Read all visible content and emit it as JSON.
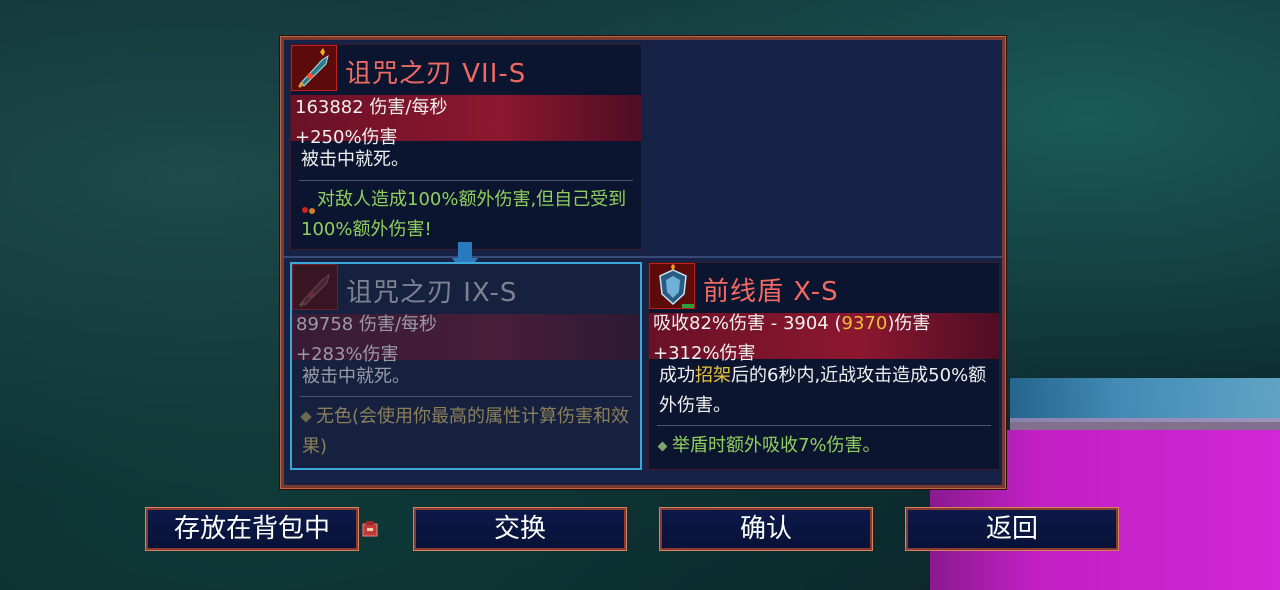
{
  "current_item": {
    "name": "诅咒之刃  VII-S",
    "dps_line": "163882 伤害/每秒",
    "damage_bonus": "+250%伤害",
    "effect": "被击中就死。",
    "curse_text": "对敌人造成100%额外伤害,但自己受到100%额外伤害!",
    "icon": "cursed-sword-icon"
  },
  "new_item": {
    "name": "诅咒之刃  IX-S",
    "dps_line": "89758 伤害/每秒",
    "damage_bonus": "+283%伤害",
    "effect": "被击中就死。",
    "bonus_text": "无色(会使用你最高的属性计算伤害和效果)",
    "icon": "cursed-sword-icon"
  },
  "shield_item": {
    "name": "前线盾  X-S",
    "absorb_prefix": "吸收82%伤害 - 3904 (",
    "absorb_highlight": "9370",
    "absorb_suffix": ")伤害",
    "damage_bonus": "+312%伤害",
    "effect_prefix": "成功",
    "effect_highlight": "招架",
    "effect_suffix": "后的6秒内,近战攻击造成50%额外伤害。",
    "bonus_text": "举盾时额外吸收7%伤害。",
    "icon": "frontline-shield-icon"
  },
  "buttons": {
    "store": "存放在背包中",
    "swap": "交换",
    "confirm": "确认",
    "back": "返回"
  },
  "colors": {
    "title_red": "#f06a62",
    "bonus_green": "#8fcf5e",
    "highlight_gold": "#e8c23a",
    "selection_blue": "#3aa8d8",
    "panel_bg": "#172247"
  }
}
